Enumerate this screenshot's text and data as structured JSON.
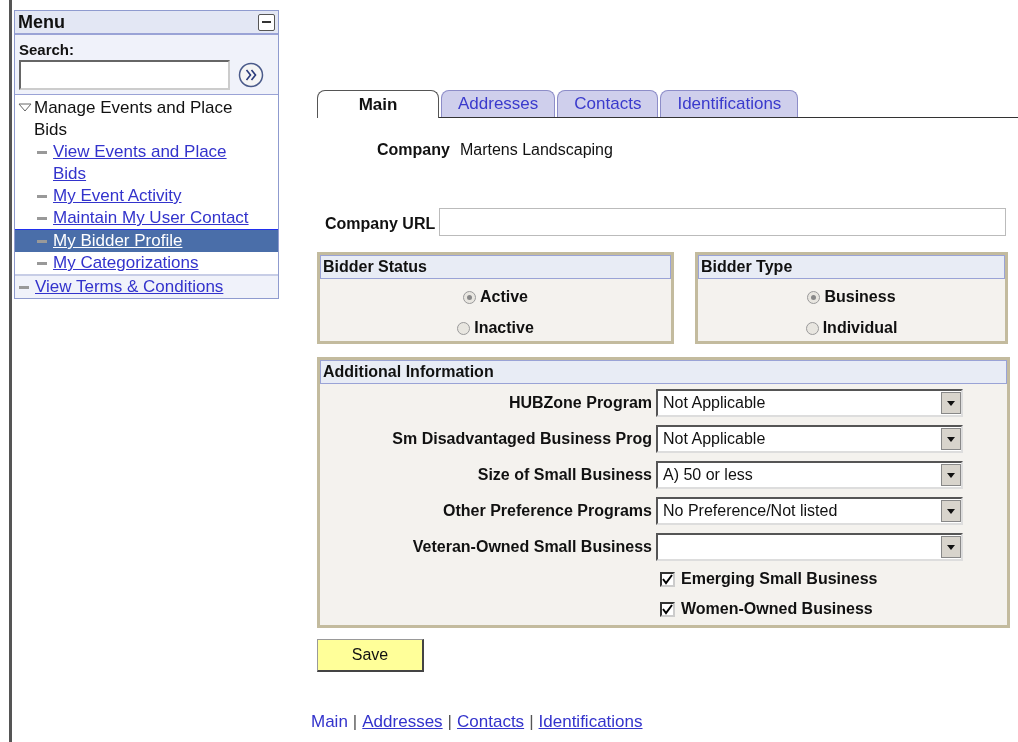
{
  "menu": {
    "title": "Menu",
    "collapsed": false,
    "search": {
      "label": "Search:"
    },
    "items": [
      {
        "kind": "folder",
        "label": "Manage Events and Place Bids",
        "expanded": true,
        "children": [
          {
            "label": "View Events and Place Bids",
            "selected": false
          },
          {
            "label": "My Event Activity",
            "selected": false
          },
          {
            "label": "Maintain My User Contact",
            "selected": false
          },
          {
            "label": "My Bidder Profile",
            "selected": true
          },
          {
            "label": "My Categorizations",
            "selected": false
          }
        ]
      },
      {
        "kind": "link",
        "label": "View Terms & Conditions",
        "selected": false
      }
    ]
  },
  "tabs": [
    {
      "label": "Main",
      "selected": true
    },
    {
      "label": "Addresses",
      "selected": false
    },
    {
      "label": "Contacts",
      "selected": false
    },
    {
      "label": "Identifications",
      "selected": false
    }
  ],
  "company": {
    "label": "Company",
    "value": "Martens Landscaping"
  },
  "company_url": {
    "label": "Company URL"
  },
  "bidder_status": {
    "title": "Bidder Status",
    "options": [
      {
        "label": "Active",
        "selected": true
      },
      {
        "label": "Inactive",
        "selected": false
      }
    ]
  },
  "bidder_type": {
    "title": "Bidder Type",
    "options": [
      {
        "label": "Business",
        "selected": true
      },
      {
        "label": "Individual",
        "selected": false
      }
    ]
  },
  "additional_information": {
    "title": "Additional Information",
    "selects": [
      {
        "label": "HUBZone Program",
        "value": "Not Applicable"
      },
      {
        "label": "Sm Disadvantaged Business Prog",
        "value": "Not Applicable"
      },
      {
        "label": "Size of Small Business",
        "value": "A) 50 or less"
      },
      {
        "label": "Other Preference Programs",
        "value": "No Preference/Not listed"
      },
      {
        "label": "Veteran-Owned Small Business"
      }
    ],
    "checkboxes": [
      {
        "label": "Emerging Small Business",
        "checked": true
      },
      {
        "label": "Women-Owned Business",
        "checked": true
      }
    ]
  },
  "save_button": "Save",
  "footer_links": [
    {
      "kind": "link",
      "label": "Main",
      "selected": true
    },
    {
      "kind": "separator",
      "label": "|"
    },
    {
      "kind": "link",
      "label": "Addresses",
      "selected": false
    },
    {
      "kind": "separator",
      "label": "|"
    },
    {
      "kind": "link",
      "label": "Contacts",
      "selected": false
    },
    {
      "kind": "separator",
      "label": "|"
    },
    {
      "kind": "link",
      "label": "Identifications",
      "selected": false
    }
  ]
}
